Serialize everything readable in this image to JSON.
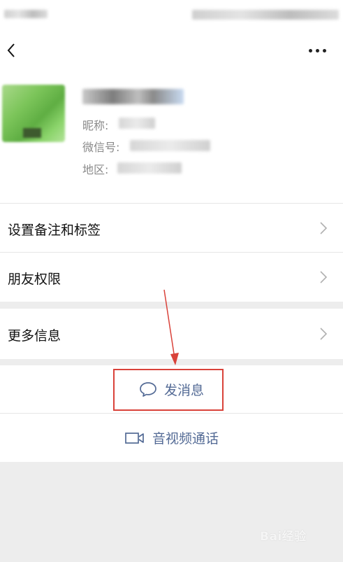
{
  "profile": {
    "nickname_label": "昵称:",
    "wechat_id_label": "微信号:",
    "region_label": "地区:"
  },
  "menu": {
    "set_remark_label": "设置备注和标签",
    "friend_permissions_label": "朋友权限",
    "more_info_label": "更多信息"
  },
  "actions": {
    "send_message_label": "发消息",
    "video_call_label": "音视频通话"
  },
  "watermark": {
    "text": "Bai经验"
  },
  "colors": {
    "link_blue": "#536a95",
    "highlight_red": "#d9423a",
    "background_gray": "#ededed"
  },
  "icons": [
    "back-arrow-icon",
    "more-dots-icon",
    "chevron-right-icon",
    "chat-bubble-icon",
    "video-camera-icon"
  ]
}
